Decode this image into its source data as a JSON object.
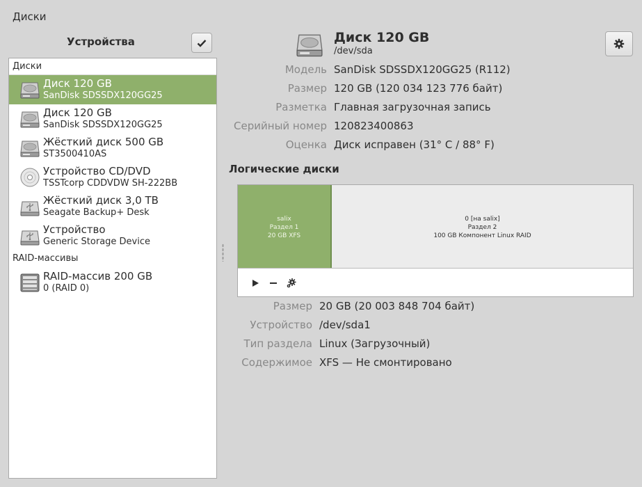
{
  "app": {
    "title": "Диски"
  },
  "sidebar": {
    "header": "Устройства",
    "sections": [
      {
        "label": "Диски",
        "items": [
          {
            "name": "Диск 120 GB",
            "sub": "SanDisk SDSSDX120GG25",
            "icon": "hard-disk-icon",
            "selected": true
          },
          {
            "name": "Диск 120 GB",
            "sub": "SanDisk SDSSDX120GG25",
            "icon": "hard-disk-icon",
            "selected": false
          },
          {
            "name": "Жёсткий диск 500 GB",
            "sub": "ST3500410AS",
            "icon": "hard-disk-icon",
            "selected": false
          },
          {
            "name": "Устройство CD/DVD",
            "sub": "TSSTcorp CDDVDW SH-222BB",
            "icon": "optical-disc-icon",
            "selected": false
          },
          {
            "name": "Жёсткий диск 3,0 TB",
            "sub": "Seagate Backup+ Desk",
            "icon": "usb-drive-icon",
            "selected": false
          },
          {
            "name": "Устройство",
            "sub": "Generic Storage Device",
            "icon": "usb-drive-icon",
            "selected": false
          }
        ]
      },
      {
        "label": "RAID-массивы",
        "items": [
          {
            "name": "RAID-массив 200 GB",
            "sub": "0 (RAID 0)",
            "icon": "raid-array-icon",
            "selected": false
          }
        ]
      }
    ]
  },
  "disk": {
    "title": "Диск 120 GB",
    "path": "/dev/sda",
    "properties": [
      {
        "label": "Модель",
        "value": "SanDisk SDSSDX120GG25 (R112)"
      },
      {
        "label": "Размер",
        "value": "120 GB (120 034 123 776 байт)"
      },
      {
        "label": "Разметка",
        "value": "Главная загрузочная запись"
      },
      {
        "label": "Серийный номер",
        "value": "120823400863"
      },
      {
        "label": "Оценка",
        "value": "Диск исправен (31° C / 88° F)"
      }
    ]
  },
  "volumes": {
    "header": "Логические диски",
    "partitions": [
      {
        "line1": "salix",
        "line2": "Раздел 1",
        "line3": "20 GB XFS",
        "selected": true
      },
      {
        "line1": "0 [на salix]",
        "line2": "Раздел 2",
        "line3": "100 GB Компонент Linux RAID",
        "selected": false
      }
    ],
    "details": [
      {
        "label": "Размер",
        "value": "20 GB (20 003 848 704 байт)"
      },
      {
        "label": "Устройство",
        "value": "/dev/sda1"
      },
      {
        "label": "Тип раздела",
        "value": "Linux (Загрузочный)"
      },
      {
        "label": "Содержимое",
        "value": "XFS — Не смонтировано"
      }
    ]
  },
  "colors": {
    "accent": "#8fb06b",
    "background": "#d6d6d6",
    "label": "#888888"
  }
}
